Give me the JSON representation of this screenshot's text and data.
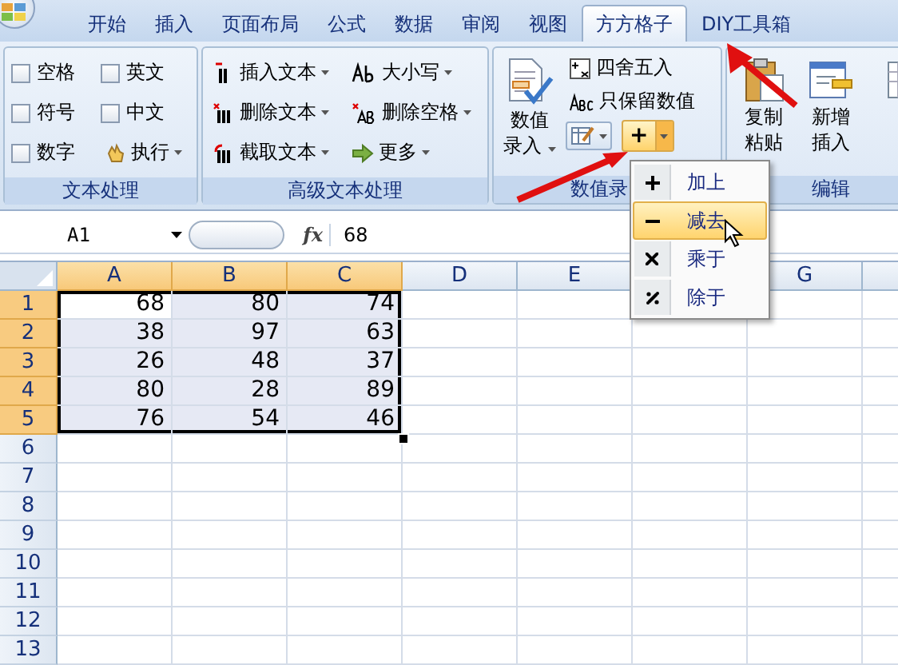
{
  "tabs": [
    {
      "label": "开始",
      "selected": false
    },
    {
      "label": "插入",
      "selected": false
    },
    {
      "label": "页面布局",
      "selected": false
    },
    {
      "label": "公式",
      "selected": false
    },
    {
      "label": "数据",
      "selected": false
    },
    {
      "label": "审阅",
      "selected": false
    },
    {
      "label": "视图",
      "selected": false
    },
    {
      "label": "方方格子",
      "selected": true
    },
    {
      "label": "DIY工具箱",
      "selected": false
    }
  ],
  "text_group": {
    "label": "文本处理",
    "options": [
      {
        "label": "空格",
        "checked": false
      },
      {
        "label": "英文",
        "checked": false
      },
      {
        "label": "符号",
        "checked": false
      },
      {
        "label": "中文",
        "checked": false
      },
      {
        "label": "数字",
        "checked": false
      }
    ],
    "run_button": "执行"
  },
  "advanced_group": {
    "label": "高级文本处理",
    "buttons": [
      {
        "label": "插入文本",
        "kind": "insert"
      },
      {
        "label": "大小写",
        "kind": "case"
      },
      {
        "label": "删除文本",
        "kind": "delete"
      },
      {
        "label": "删除空格",
        "kind": "space"
      },
      {
        "label": "截取文本",
        "kind": "cut"
      },
      {
        "label": "更多",
        "kind": "more"
      }
    ]
  },
  "number_group": {
    "label": "数值录",
    "entry_button": {
      "line1": "数值",
      "line2": "录入"
    },
    "round_button": "四舍五入",
    "keep_values_button": "只保留数值",
    "operation_button": "+"
  },
  "edit_group": {
    "label": "编辑",
    "buttons": [
      {
        "line1": "复制",
        "line2": "粘贴",
        "kind": "paste"
      },
      {
        "line1": "新增",
        "line2": "插入",
        "kind": "insert"
      },
      {
        "kind": "table"
      }
    ]
  },
  "formula_bar": {
    "name_box": "A1",
    "function_label": "fx",
    "value": "68"
  },
  "columns": [
    {
      "label": "A",
      "selected": true
    },
    {
      "label": "B",
      "selected": true
    },
    {
      "label": "C",
      "selected": true
    },
    {
      "label": "D",
      "selected": false
    },
    {
      "label": "E",
      "selected": false
    },
    {},
    {
      "label": "G",
      "selected": false
    },
    {
      "selected": false
    }
  ],
  "rows": [
    {
      "number": "1",
      "selected": true,
      "cells": [
        {
          "value": "68",
          "active": true
        },
        {
          "value": "80",
          "active": false
        },
        {
          "value": "74",
          "active": false
        }
      ]
    },
    {
      "number": "2",
      "selected": true,
      "cells": [
        {
          "value": "38",
          "active": false
        },
        {
          "value": "97",
          "active": false
        },
        {
          "value": "63",
          "active": false
        }
      ]
    },
    {
      "number": "3",
      "selected": true,
      "cells": [
        {
          "value": "26",
          "active": false
        },
        {
          "value": "48",
          "active": false
        },
        {
          "value": "37",
          "active": false
        }
      ]
    },
    {
      "number": "4",
      "selected": true,
      "cells": [
        {
          "value": "80",
          "active": false
        },
        {
          "value": "28",
          "active": false
        },
        {
          "value": "89",
          "active": false
        }
      ]
    },
    {
      "number": "5",
      "selected": true,
      "cells": [
        {
          "value": "76",
          "active": false
        },
        {
          "value": "54",
          "active": false
        },
        {
          "value": "46",
          "active": false
        }
      ]
    },
    {
      "number": "6",
      "selected": false
    },
    {
      "number": "7",
      "selected": false
    },
    {
      "number": "8",
      "selected": false
    },
    {
      "number": "9",
      "selected": false
    },
    {
      "number": "10",
      "selected": false
    },
    {
      "number": "11",
      "selected": false
    },
    {
      "number": "12",
      "selected": false
    },
    {
      "number": "13",
      "selected": false
    }
  ],
  "menu": {
    "items": [
      {
        "kind": "add",
        "label": "加上",
        "selected": false
      },
      {
        "kind": "subtract",
        "label": "减去",
        "selected": true
      },
      {
        "kind": "multiply",
        "label": "乘于",
        "selected": false
      },
      {
        "kind": "divide",
        "label": "除于",
        "selected": false
      }
    ]
  }
}
